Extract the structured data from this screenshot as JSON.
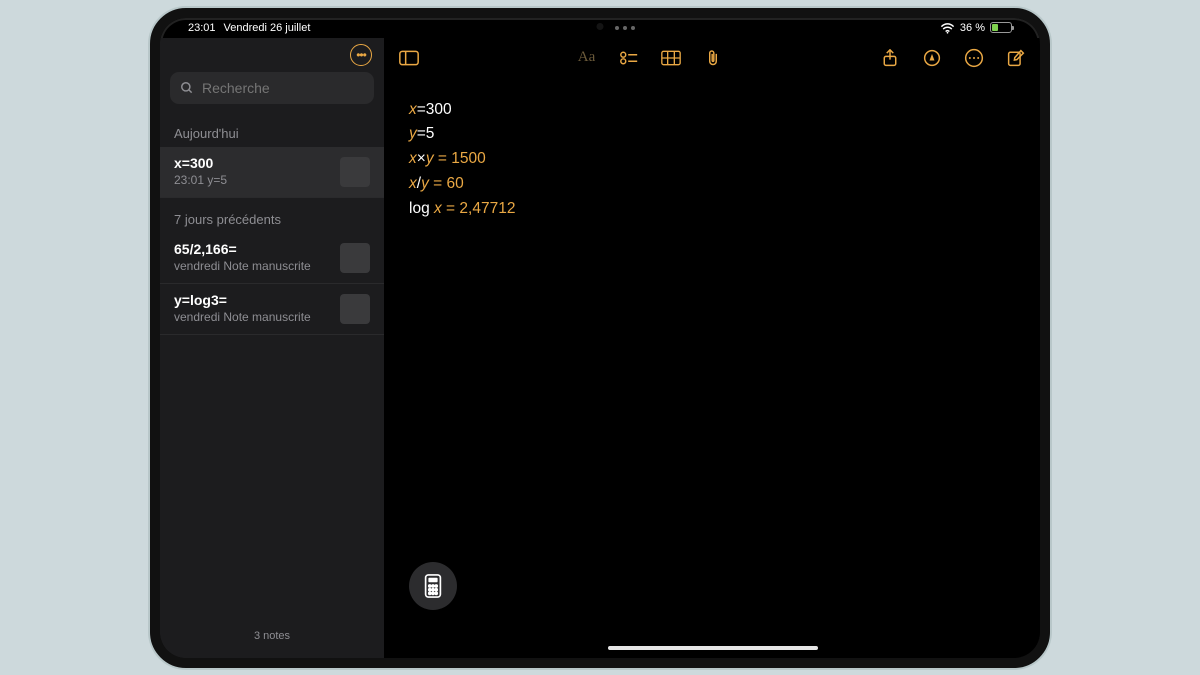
{
  "status": {
    "time": "23:01",
    "date": "Vendredi 26 juillet",
    "battery_text": "36 %",
    "battery_level": 36
  },
  "accent": "#eaa844",
  "sidebar": {
    "search_placeholder": "Recherche",
    "sections": [
      {
        "header": "Aujourd'hui",
        "items": [
          {
            "title": "x=300",
            "sub": "23:01  y=5",
            "selected": true,
            "thumb": true
          }
        ]
      },
      {
        "header": "7 jours précédents",
        "items": [
          {
            "title": "65/2,166=",
            "sub": "vendredi  Note manuscrite",
            "selected": false,
            "thumb": true
          },
          {
            "title": "y=log3=",
            "sub": "vendredi  Note manuscrite",
            "selected": false,
            "thumb": true
          }
        ]
      }
    ],
    "footer": "3 notes"
  },
  "note": {
    "lines": [
      {
        "pre": "",
        "var": "x",
        "mid": "=300",
        "op": "",
        "res": ""
      },
      {
        "pre": "",
        "var": "y",
        "mid": "=5",
        "op": "",
        "res": ""
      },
      {
        "pre": "",
        "var": "x",
        "mid": "×",
        "var2": "y",
        "op": " = ",
        "res": "1500"
      },
      {
        "pre": "",
        "var": "x",
        "mid": "/",
        "var2": "y",
        "op": " = ",
        "res": "60"
      },
      {
        "pre": "log ",
        "var": "x",
        "mid": "",
        "op": " = ",
        "res": "2,47712"
      }
    ]
  },
  "toolbar": {
    "left": [
      "panel-icon"
    ],
    "center": [
      "text-format-icon",
      "checklist-icon",
      "table-icon",
      "attachment-icon"
    ],
    "right": [
      "share-icon",
      "markup-icon",
      "more-icon",
      "compose-icon"
    ]
  }
}
